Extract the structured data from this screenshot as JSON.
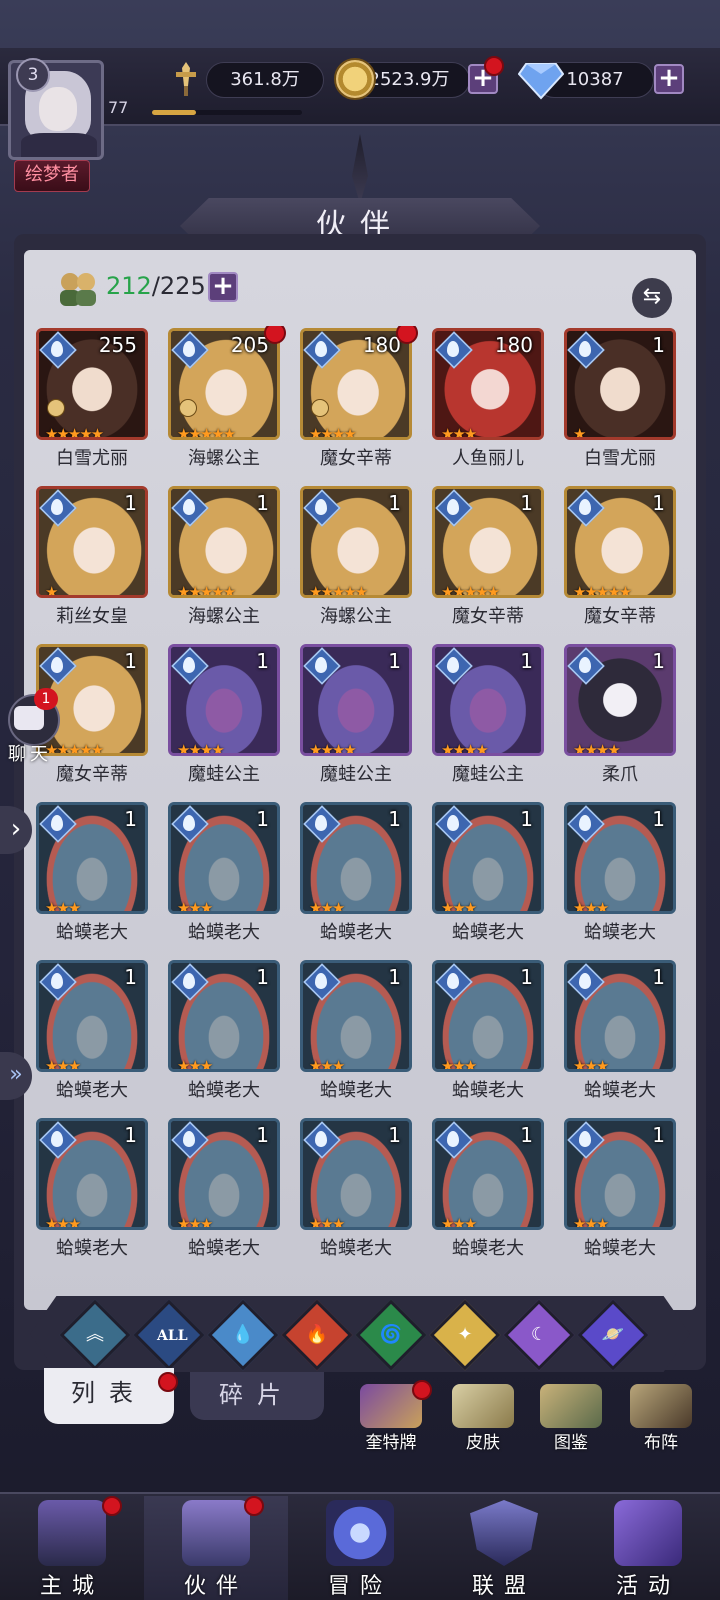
{
  "player": {
    "level": "3",
    "exp": "77",
    "title": "绘梦者",
    "power": "361.8万",
    "gold": "2523.9万",
    "gems": "10387"
  },
  "header": {
    "title": "伙伴"
  },
  "roster": {
    "current": "212",
    "total": "/225"
  },
  "cards": [
    {
      "name": "白雪尤丽",
      "level": "255",
      "stars": "★★★★★",
      "art": "hair-dark",
      "frame": "red",
      "dot": false,
      "equip": true
    },
    {
      "name": "海螺公主",
      "level": "205",
      "stars": "★★★★★",
      "art": "hair-blonde",
      "frame": "gold",
      "dot": true,
      "equip": true
    },
    {
      "name": "魔女辛蒂",
      "level": "180",
      "stars": "★★★★",
      "art": "hair-blonde",
      "frame": "gold",
      "dot": true,
      "equip": true
    },
    {
      "name": "人鱼丽儿",
      "level": "180",
      "stars": "★★★",
      "art": "hair-red",
      "frame": "red",
      "dot": false,
      "equip": false
    },
    {
      "name": "白雪尤丽",
      "level": "1",
      "stars": "★",
      "art": "hair-dark",
      "frame": "red",
      "dot": false,
      "equip": false
    },
    {
      "name": "莉丝女皇",
      "level": "1",
      "stars": "★",
      "art": "hair-blonde",
      "frame": "red",
      "dot": false,
      "equip": false
    },
    {
      "name": "海螺公主",
      "level": "1",
      "stars": "★★★★★",
      "art": "hair-blonde",
      "frame": "gold",
      "dot": false,
      "equip": false
    },
    {
      "name": "海螺公主",
      "level": "1",
      "stars": "★★★★★",
      "art": "hair-blonde",
      "frame": "gold",
      "dot": false,
      "equip": false
    },
    {
      "name": "魔女辛蒂",
      "level": "1",
      "stars": "★★★★★",
      "art": "hair-blonde",
      "frame": "gold",
      "dot": false,
      "equip": false
    },
    {
      "name": "魔女辛蒂",
      "level": "1",
      "stars": "★★★★★",
      "art": "hair-blonde",
      "frame": "gold",
      "dot": false,
      "equip": false
    },
    {
      "name": "魔女辛蒂",
      "level": "1",
      "stars": "★★★★★",
      "art": "hair-blonde",
      "frame": "gold",
      "dot": false,
      "equip": false
    },
    {
      "name": "魔蛙公主",
      "level": "1",
      "stars": "★★★★",
      "art": "frog-purple",
      "frame": "purple",
      "dot": false,
      "equip": false
    },
    {
      "name": "魔蛙公主",
      "level": "1",
      "stars": "★★★★",
      "art": "frog-purple",
      "frame": "purple",
      "dot": false,
      "equip": false
    },
    {
      "name": "魔蛙公主",
      "level": "1",
      "stars": "★★★★",
      "art": "frog-purple",
      "frame": "purple",
      "dot": false,
      "equip": false
    },
    {
      "name": "柔爪",
      "level": "1",
      "stars": "★★★★",
      "art": "cat",
      "frame": "purple",
      "dot": false,
      "equip": false
    },
    {
      "name": "蛤蟆老大",
      "level": "1",
      "stars": "★★★",
      "art": "toad",
      "frame": "blue",
      "dot": false,
      "equip": false
    },
    {
      "name": "蛤蟆老大",
      "level": "1",
      "stars": "★★★",
      "art": "toad",
      "frame": "blue",
      "dot": false,
      "equip": false
    },
    {
      "name": "蛤蟆老大",
      "level": "1",
      "stars": "★★★",
      "art": "toad",
      "frame": "blue",
      "dot": false,
      "equip": false
    },
    {
      "name": "蛤蟆老大",
      "level": "1",
      "stars": "★★★",
      "art": "toad",
      "frame": "blue",
      "dot": false,
      "equip": false
    },
    {
      "name": "蛤蟆老大",
      "level": "1",
      "stars": "★★★",
      "art": "toad",
      "frame": "blue",
      "dot": false,
      "equip": false
    },
    {
      "name": "蛤蟆老大",
      "level": "1",
      "stars": "★★★",
      "art": "toad",
      "frame": "blue",
      "dot": false,
      "equip": false
    },
    {
      "name": "蛤蟆老大",
      "level": "1",
      "stars": "★★★",
      "art": "toad",
      "frame": "blue",
      "dot": false,
      "equip": false
    },
    {
      "name": "蛤蟆老大",
      "level": "1",
      "stars": "★★★",
      "art": "toad",
      "frame": "blue",
      "dot": false,
      "equip": false
    },
    {
      "name": "蛤蟆老大",
      "level": "1",
      "stars": "★★★",
      "art": "toad",
      "frame": "blue",
      "dot": false,
      "equip": false
    },
    {
      "name": "蛤蟆老大",
      "level": "1",
      "stars": "★★★",
      "art": "toad",
      "frame": "blue",
      "dot": false,
      "equip": false
    },
    {
      "name": "蛤蟆老大",
      "level": "1",
      "stars": "★★★",
      "art": "toad",
      "frame": "blue",
      "dot": false,
      "equip": false
    },
    {
      "name": "蛤蟆老大",
      "level": "1",
      "stars": "★★★",
      "art": "toad",
      "frame": "blue",
      "dot": false,
      "equip": false
    },
    {
      "name": "蛤蟆老大",
      "level": "1",
      "stars": "★★★",
      "art": "toad",
      "frame": "blue",
      "dot": false,
      "equip": false
    },
    {
      "name": "蛤蟆老大",
      "level": "1",
      "stars": "★★★",
      "art": "toad",
      "frame": "blue",
      "dot": false,
      "equip": false
    },
    {
      "name": "蛤蟆老大",
      "level": "1",
      "stars": "★★★",
      "art": "toad",
      "frame": "blue",
      "dot": false,
      "equip": false
    }
  ],
  "filters": {
    "all_label": "ALL",
    "items": [
      "air",
      "all",
      "water",
      "fire",
      "nature",
      "light",
      "dark",
      "cosmic"
    ],
    "colors": {
      "air": "#3b6c8a",
      "all": "#2b4a82",
      "water": "#4a8ac9",
      "fire": "#c6432f",
      "nature": "#2b8a4a",
      "light": "#d9b24a",
      "dark": "#8a58c9",
      "cosmic": "#5a4ac9"
    }
  },
  "tabs": {
    "list": "列表",
    "fragments": "碎片"
  },
  "subnav": {
    "cards": "奎特牌",
    "skins": "皮肤",
    "codex": "图鉴",
    "formation": "布阵"
  },
  "chat": {
    "label": "聊天",
    "count": "1"
  },
  "nav": {
    "city": "主城",
    "partners": "伙伴",
    "adventure": "冒险",
    "alliance": "联盟",
    "events": "活动"
  }
}
